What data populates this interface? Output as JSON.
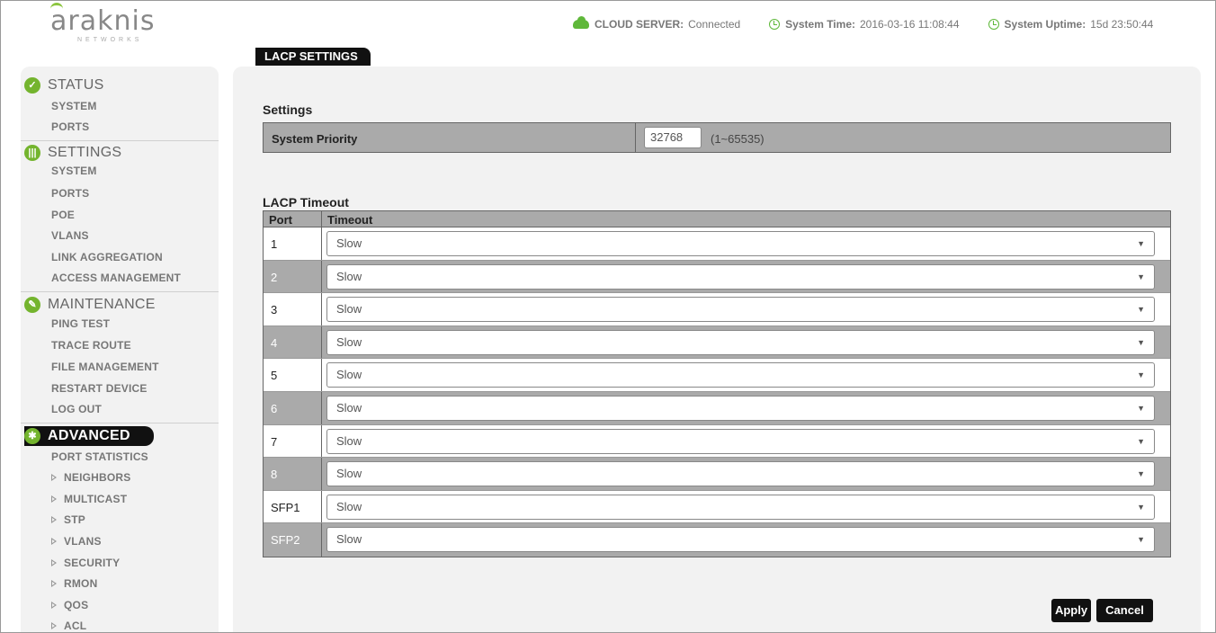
{
  "logo": {
    "text": "araknis",
    "subtext": "NETWORKS"
  },
  "header": {
    "cloud_label": "CLOUD SERVER:",
    "cloud_value": "Connected",
    "time_label": "System Time:",
    "time_value": "2016-03-16 11:08:44",
    "uptime_label": "System Uptime:",
    "uptime_value": "15d 23:50:44"
  },
  "page_tab": "LACP SETTINGS",
  "sidebar": {
    "status": {
      "title": "STATUS",
      "items": [
        "SYSTEM",
        "PORTS"
      ]
    },
    "settings": {
      "title": "SETTINGS",
      "items": [
        "SYSTEM",
        "PORTS",
        "POE",
        "VLANS",
        "LINK AGGREGATION",
        "ACCESS MANAGEMENT"
      ]
    },
    "maintenance": {
      "title": "MAINTENANCE",
      "items": [
        "PING TEST",
        "TRACE ROUTE",
        "FILE MANAGEMENT",
        "RESTART DEVICE",
        "LOG OUT"
      ]
    },
    "advanced": {
      "title": "ADVANCED",
      "items": [
        "PORT STATISTICS",
        "NEIGHBORS",
        "MULTICAST",
        "STP",
        "VLANS",
        "SECURITY",
        "RMON",
        "QOS",
        "ACL"
      ]
    }
  },
  "settings_block": {
    "title": "Settings",
    "priority_label": "System Priority",
    "priority_value": "32768",
    "priority_range": "(1~65535)"
  },
  "lacp": {
    "title": "LACP Timeout",
    "col_port": "Port",
    "col_timeout": "Timeout",
    "rows": [
      {
        "port": "1",
        "timeout": "Slow"
      },
      {
        "port": "2",
        "timeout": "Slow"
      },
      {
        "port": "3",
        "timeout": "Slow"
      },
      {
        "port": "4",
        "timeout": "Slow"
      },
      {
        "port": "5",
        "timeout": "Slow"
      },
      {
        "port": "6",
        "timeout": "Slow"
      },
      {
        "port": "7",
        "timeout": "Slow"
      },
      {
        "port": "8",
        "timeout": "Slow"
      },
      {
        "port": "SFP1",
        "timeout": "Slow"
      },
      {
        "port": "SFP2",
        "timeout": "Slow"
      }
    ]
  },
  "buttons": {
    "apply": "Apply",
    "cancel": "Cancel"
  },
  "colors": {
    "accent_green": "#74b42e",
    "header_bar": "#111111",
    "table_shade": "#aaaaaa"
  }
}
